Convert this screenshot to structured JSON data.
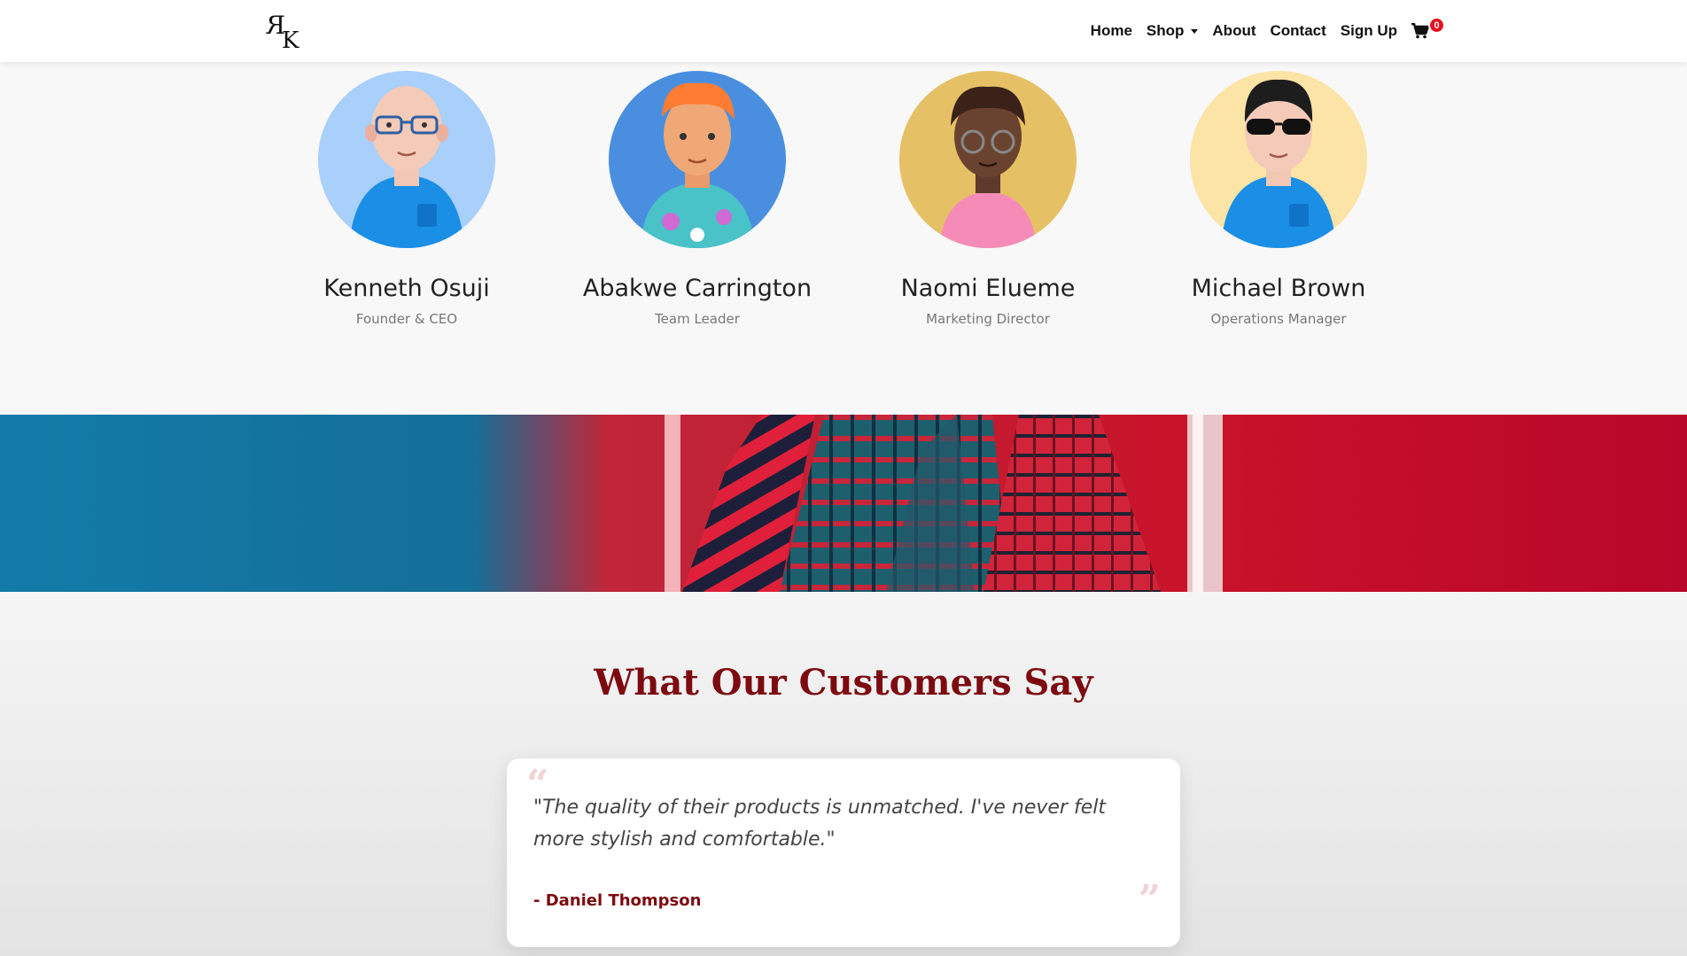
{
  "nav": {
    "logo_alt": "RK logo",
    "links": [
      "Home",
      "Shop",
      "About",
      "Contact",
      "Sign Up"
    ],
    "cart_count": "0"
  },
  "team": [
    {
      "name": "Kenneth Osuji",
      "role": "Founder & CEO",
      "bg": "#a9cffb"
    },
    {
      "name": "Abakwe Carrington",
      "role": "Team Leader",
      "bg": "#4a8fdf"
    },
    {
      "name": "Naomi Elueme",
      "role": "Marketing Director",
      "bg": "#e6c065"
    },
    {
      "name": "Michael Brown",
      "role": "Operations Manager",
      "bg": "#fce3a6"
    }
  ],
  "testimonials": {
    "title": "What Our Customers Say",
    "quote": "\"The quality of their products is unmatched. I've never felt more stylish and comfortable.\"",
    "author": "- Daniel Thompson"
  },
  "colors": {
    "accent": "#7d0a10",
    "badge": "#e8101f"
  }
}
